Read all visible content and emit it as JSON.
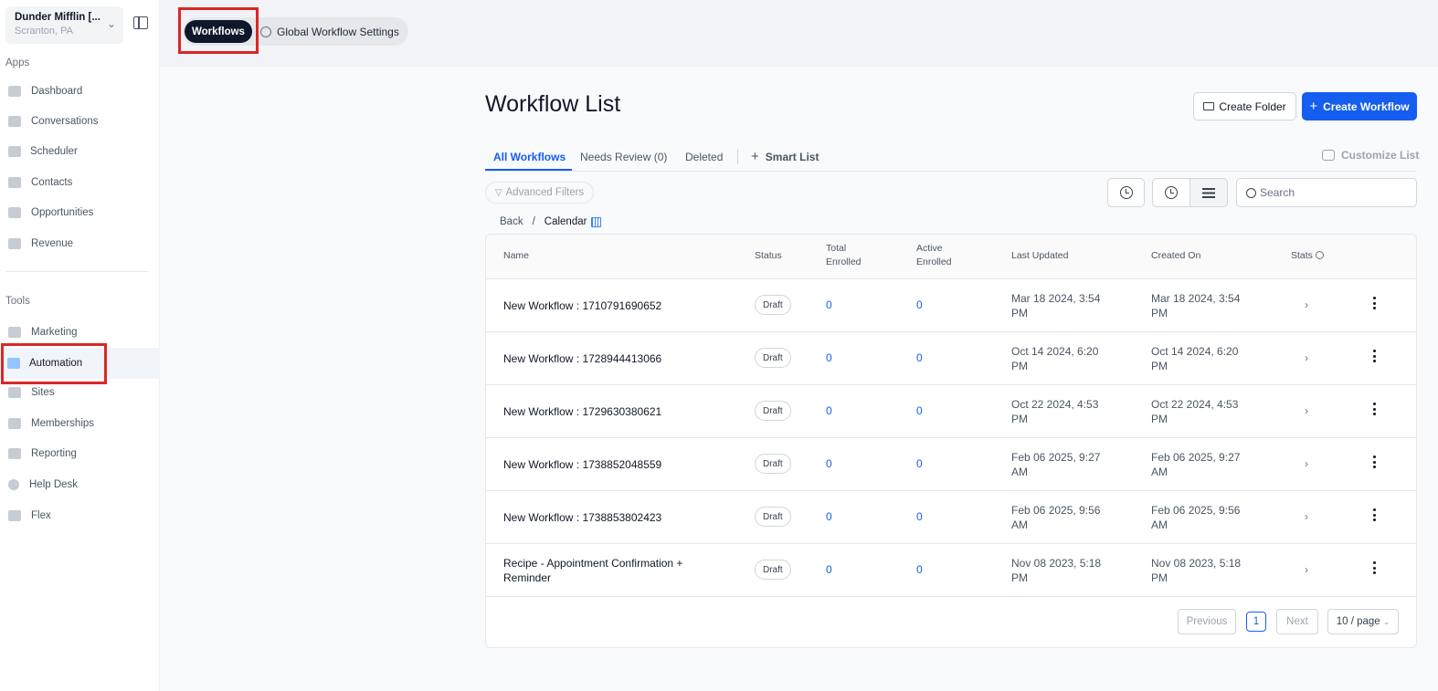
{
  "sidebar": {
    "account_name": "Dunder Mifflin [...",
    "account_location": "Scranton, PA",
    "apps_title": "Apps",
    "tools_title": "Tools",
    "apps": [
      {
        "label": "Dashboard",
        "icon": "dashboard-icon"
      },
      {
        "label": "Conversations",
        "icon": "conversations-icon"
      },
      {
        "label": "Scheduler",
        "icon": "calendar-icon"
      },
      {
        "label": "Contacts",
        "icon": "user-icon"
      },
      {
        "label": "Opportunities",
        "icon": "target-icon"
      },
      {
        "label": "Revenue",
        "icon": "card-icon"
      }
    ],
    "tools": [
      {
        "label": "Marketing",
        "icon": "megaphone-icon"
      },
      {
        "label": "Automation",
        "icon": "gears-icon"
      },
      {
        "label": "Sites",
        "icon": "globe-icon"
      },
      {
        "label": "Memberships",
        "icon": "people-icon"
      },
      {
        "label": "Reporting",
        "icon": "pie-chart-icon"
      },
      {
        "label": "Help Desk",
        "icon": "help-icon"
      },
      {
        "label": "Flex",
        "icon": "group-icon"
      }
    ]
  },
  "topbar": {
    "tab_workflows": "Workflows",
    "tab_global": "Global Workflow Settings"
  },
  "main": {
    "title": "Workflow List",
    "create_folder": "Create Folder",
    "create_workflow": "Create Workflow",
    "tabs": {
      "all": "All Workflows",
      "review": "Needs Review (0)",
      "deleted": "Deleted",
      "smart_list": "Smart List"
    },
    "customize": "Customize List",
    "advanced_filters": "Advanced Filters",
    "search_placeholder": "Search",
    "breadcrumb": {
      "back": "Back",
      "sep": "/",
      "current": "Calendar"
    }
  },
  "table": {
    "headers": {
      "name": "Name",
      "status": "Status",
      "total_1": "Total",
      "total_2": "Enrolled",
      "active_1": "Active",
      "active_2": "Enrolled",
      "updated": "Last Updated",
      "created": "Created On",
      "stats": "Stats"
    },
    "rows": [
      {
        "name": "New Workflow : 1710791690652",
        "status": "Draft",
        "total": "0",
        "active": "0",
        "updated": "Mar 18 2024, 3:54 PM",
        "created": "Mar 18 2024, 3:54 PM"
      },
      {
        "name": "New Workflow : 1728944413066",
        "status": "Draft",
        "total": "0",
        "active": "0",
        "updated": "Oct 14 2024, 6:20 PM",
        "created": "Oct 14 2024, 6:20 PM"
      },
      {
        "name": "New Workflow : 1729630380621",
        "status": "Draft",
        "total": "0",
        "active": "0",
        "updated": "Oct 22 2024, 4:53 PM",
        "created": "Oct 22 2024, 4:53 PM"
      },
      {
        "name": "New Workflow : 1738852048559",
        "status": "Draft",
        "total": "0",
        "active": "0",
        "updated": "Feb 06 2025, 9:27 AM",
        "created": "Feb 06 2025, 9:27 AM"
      },
      {
        "name": "New Workflow : 1738853802423",
        "status": "Draft",
        "total": "0",
        "active": "0",
        "updated": "Feb 06 2025, 9:56 AM",
        "created": "Feb 06 2025, 9:56 AM"
      },
      {
        "name": "Recipe - Appointment Confirmation + Reminder",
        "status": "Draft",
        "total": "0",
        "active": "0",
        "updated": "Nov 08 2023, 5:18 PM",
        "created": "Nov 08 2023, 5:18 PM"
      }
    ]
  },
  "pagination": {
    "previous": "Previous",
    "page": "1",
    "next": "Next",
    "page_size": "10 / page"
  },
  "colors": {
    "accent": "#155eef",
    "highlight": "#dc2626",
    "tab_active_bg": "#0f172a"
  }
}
